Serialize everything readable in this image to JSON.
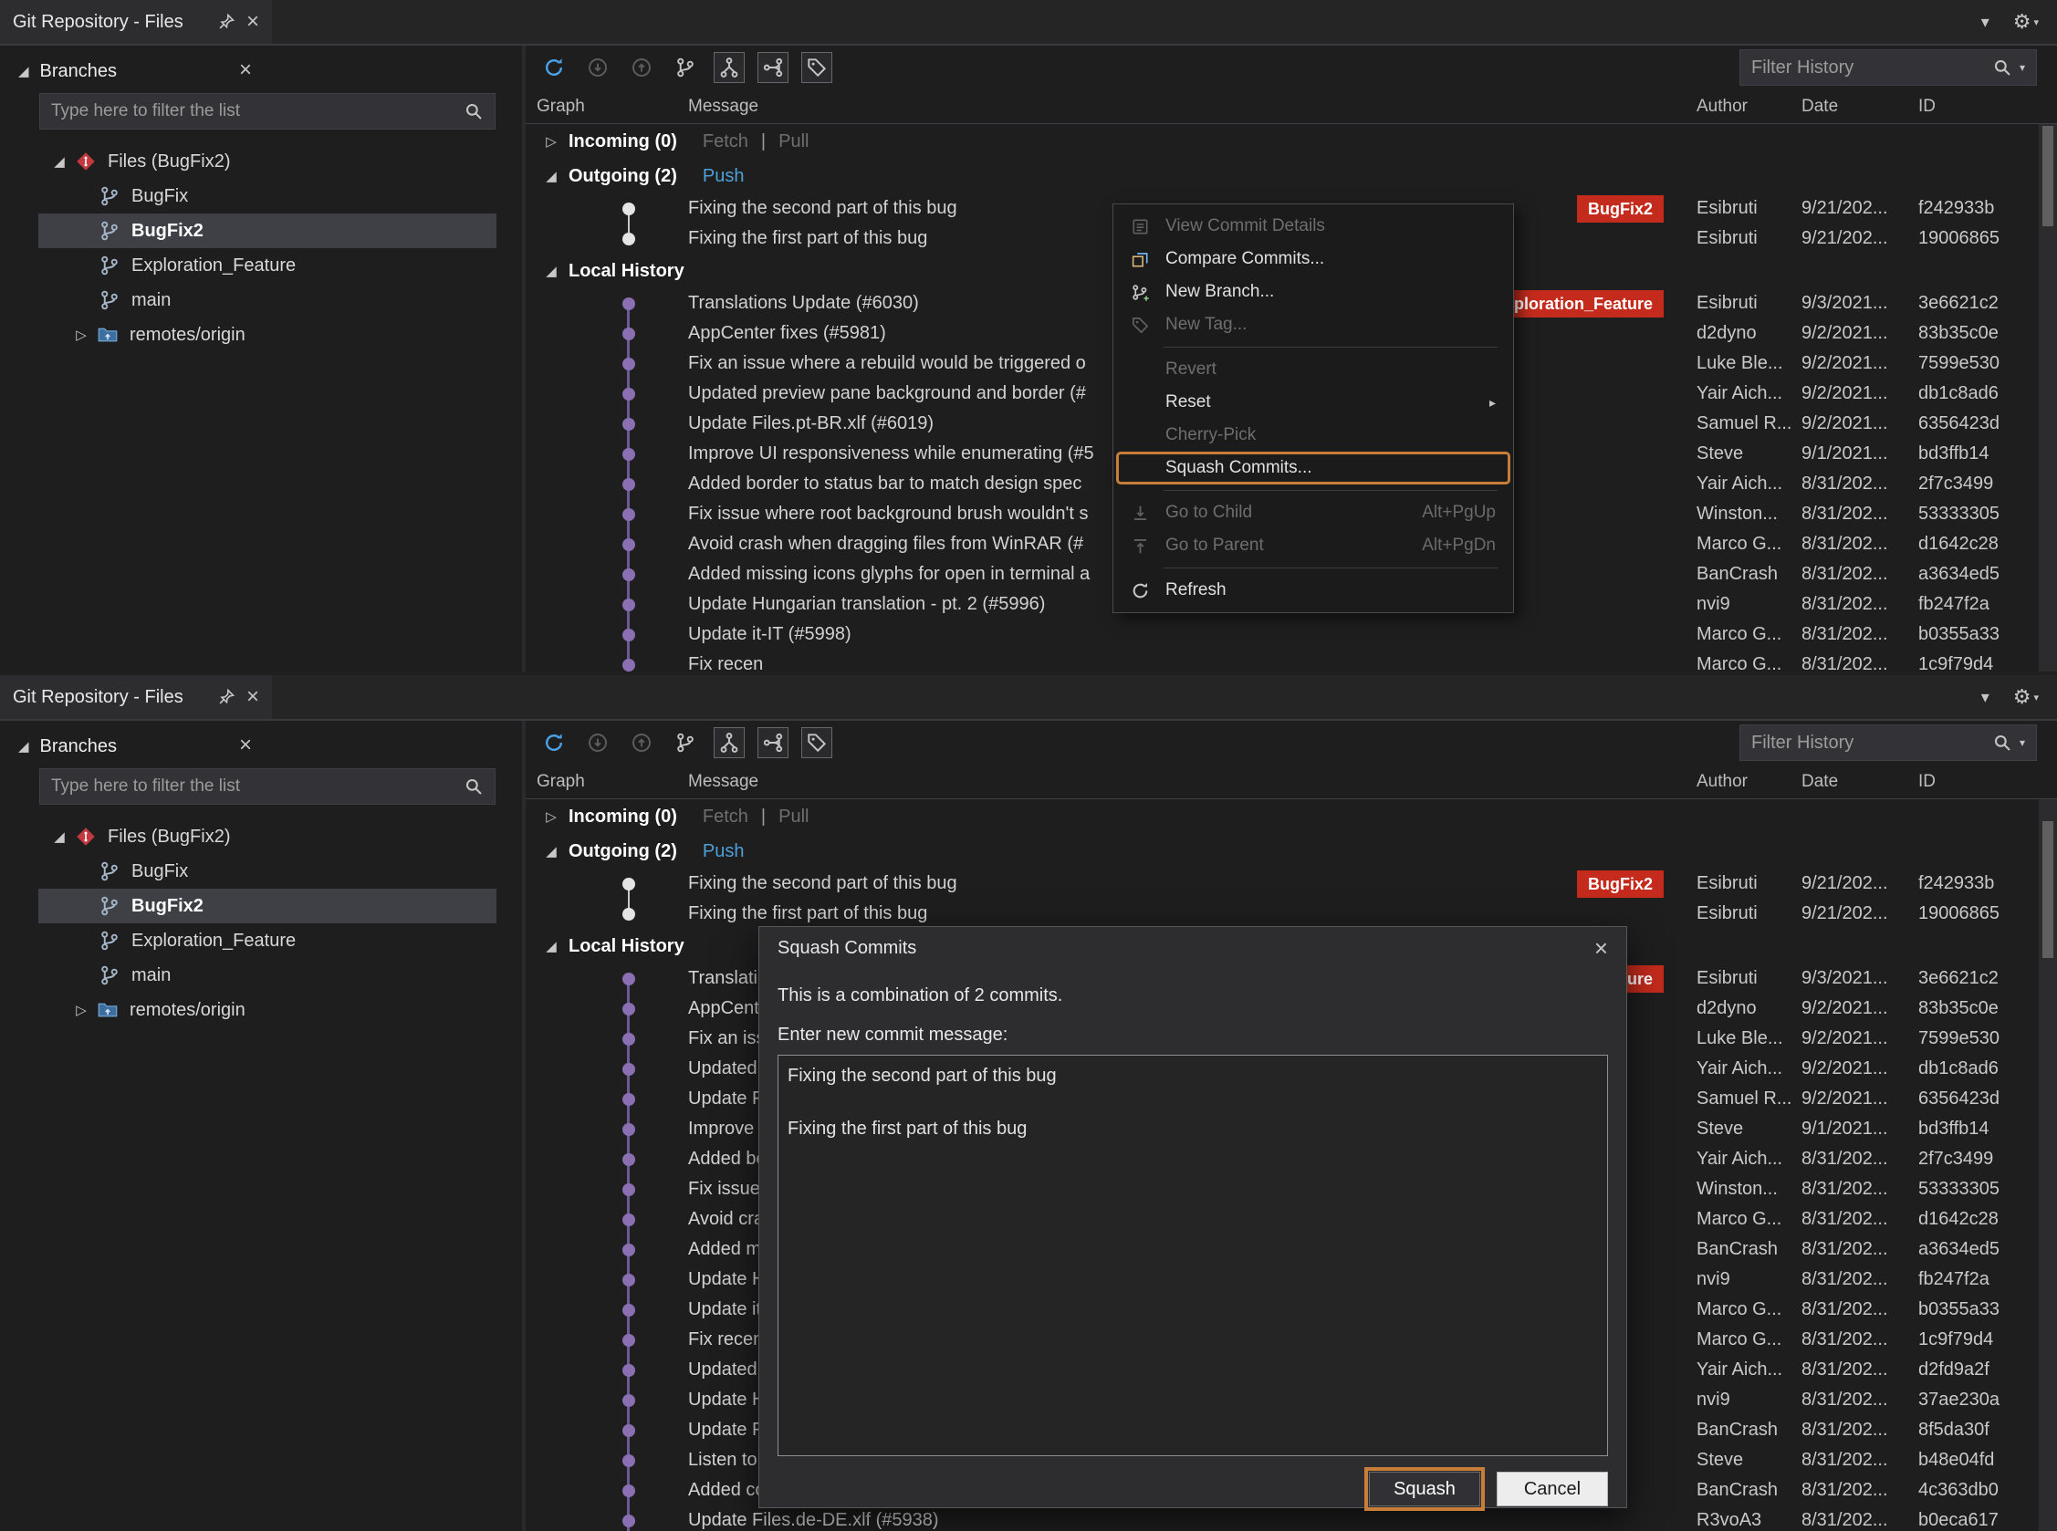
{
  "window": {
    "tab_title": "Git Repository - Files",
    "branches": {
      "header": "Branches",
      "filter_placeholder": "Type here to filter the list",
      "repo_label": "Files (BugFix2)",
      "items": [
        {
          "label": "BugFix"
        },
        {
          "label": "BugFix2",
          "selected": true
        },
        {
          "label": "Exploration_Feature"
        },
        {
          "label": "main"
        }
      ],
      "remote_label": "remotes/origin"
    },
    "history": {
      "filter_placeholder": "Filter History",
      "columns": {
        "graph": "Graph",
        "message": "Message",
        "author": "Author",
        "date": "Date",
        "id": "ID"
      },
      "incoming_label": "Incoming (0)",
      "fetch_label": "Fetch",
      "pull_label": "Pull",
      "outgoing_label": "Outgoing (2)",
      "push_label": "Push",
      "local_history_label": "Local History",
      "outgoing_commits": [
        {
          "message": "Fixing the second part of this bug",
          "badge": "BugFix2",
          "author": "Esibruti",
          "date": "9/21/202...",
          "id": "f242933b"
        },
        {
          "message": "Fixing the first part of this bug",
          "author": "Esibruti",
          "date": "9/21/202...",
          "id": "19006865"
        }
      ],
      "local_commits": [
        {
          "message": "Translations Update (#6030)",
          "badge": "Exploration_Feature",
          "author": "Esibruti",
          "date": "9/3/2021...",
          "id": "3e6621c2"
        },
        {
          "message": "AppCenter fixes (#5981)",
          "author": "d2dyno",
          "date": "9/2/2021...",
          "id": "83b35c0e"
        },
        {
          "message": "Fix an issue where a rebuild would be triggered o",
          "author": "Luke Ble...",
          "date": "9/2/2021...",
          "id": "7599e530"
        },
        {
          "message": "Updated preview pane background and border (#",
          "author": "Yair Aich...",
          "date": "9/2/2021...",
          "id": "db1c8ad6"
        },
        {
          "message": "Update Files.pt-BR.xlf (#6019)",
          "author": "Samuel R...",
          "date": "9/2/2021...",
          "id": "6356423d"
        },
        {
          "message": "Improve UI responsiveness while enumerating (#5",
          "author": "Steve",
          "date": "9/1/2021...",
          "id": "bd3ffb14"
        },
        {
          "message": "Added border to status bar to match design spec",
          "author": "Yair Aich...",
          "date": "8/31/202...",
          "id": "2f7c3499"
        },
        {
          "message": "Fix issue where root background brush wouldn't s",
          "author": "Winston...",
          "date": "8/31/202...",
          "id": "53333305"
        },
        {
          "message": "Avoid crash when dragging files from WinRAR (#",
          "author": "Marco G...",
          "date": "8/31/202...",
          "id": "d1642c28"
        },
        {
          "message": "Added missing icons glyphs for open in terminal a",
          "author": "BanCrash",
          "date": "8/31/202...",
          "id": "a3634ed5"
        },
        {
          "message": "Update Hungarian translation - pt. 2 (#5996)",
          "author": "nvi9",
          "date": "8/31/202...",
          "id": "fb247f2a"
        },
        {
          "message": "Update it-IT (#5998)",
          "author": "Marco G...",
          "date": "8/31/202...",
          "id": "b0355a33"
        },
        {
          "message": "Fix recen",
          "author": "Marco G...",
          "date": "8/31/202...",
          "id": "1c9f79d4"
        },
        {
          "message": "Updated",
          "author": "Yair Aich...",
          "date": "8/31/202...",
          "id": "d2fd9a2f"
        },
        {
          "message": "Update H",
          "author": "nvi9",
          "date": "8/31/202...",
          "id": "37ae230a"
        },
        {
          "message": "Update F",
          "author": "BanCrash",
          "date": "8/31/202...",
          "id": "8f5da30f"
        },
        {
          "message": "Listen to",
          "author": "Steve",
          "date": "8/31/202...",
          "id": "b48e04fd"
        },
        {
          "message": "Added co",
          "author": "BanCrash",
          "date": "8/31/202...",
          "id": "4c363db0"
        },
        {
          "message": "Update Files.de-DE.xlf (#5938)",
          "author": "R3voA3",
          "date": "8/31/202...",
          "id": "b0eca617"
        }
      ]
    }
  },
  "context_menu": {
    "items": [
      {
        "label": "View Commit Details",
        "icon": "commit-details-icon",
        "disabled": true
      },
      {
        "label": "Compare Commits...",
        "icon": "compare-icon"
      },
      {
        "label": "New Branch...",
        "icon": "new-branch-icon"
      },
      {
        "label": "New Tag...",
        "icon": "tag-icon",
        "disabled": true
      },
      {
        "separator": true
      },
      {
        "label": "Revert",
        "disabled": true
      },
      {
        "label": "Reset",
        "submenu": true
      },
      {
        "label": "Cherry-Pick",
        "disabled": true
      },
      {
        "label": "Squash Commits...",
        "highlighted": true
      },
      {
        "separator": true
      },
      {
        "label": "Go to Child",
        "icon": "go-child-icon",
        "disabled": true,
        "shortcut": "Alt+PgUp"
      },
      {
        "label": "Go to Parent",
        "icon": "go-parent-icon",
        "disabled": true,
        "shortcut": "Alt+PgDn"
      },
      {
        "separator": true
      },
      {
        "label": "Refresh",
        "icon": "refresh-icon"
      }
    ]
  },
  "dialog": {
    "title": "Squash Commits",
    "description": "This is a combination of 2 commits.",
    "message_label": "Enter new commit message:",
    "message_value": "Fixing the second part of this bug\n\nFixing the first part of this bug",
    "squash_button": "Squash",
    "cancel_button": "Cancel"
  },
  "colors": {
    "badge_red": "#C42B1C",
    "annotation_orange": "#C87E39",
    "push_link_blue": "#4EA0DA",
    "graph_purple": "#8A6FB3"
  }
}
